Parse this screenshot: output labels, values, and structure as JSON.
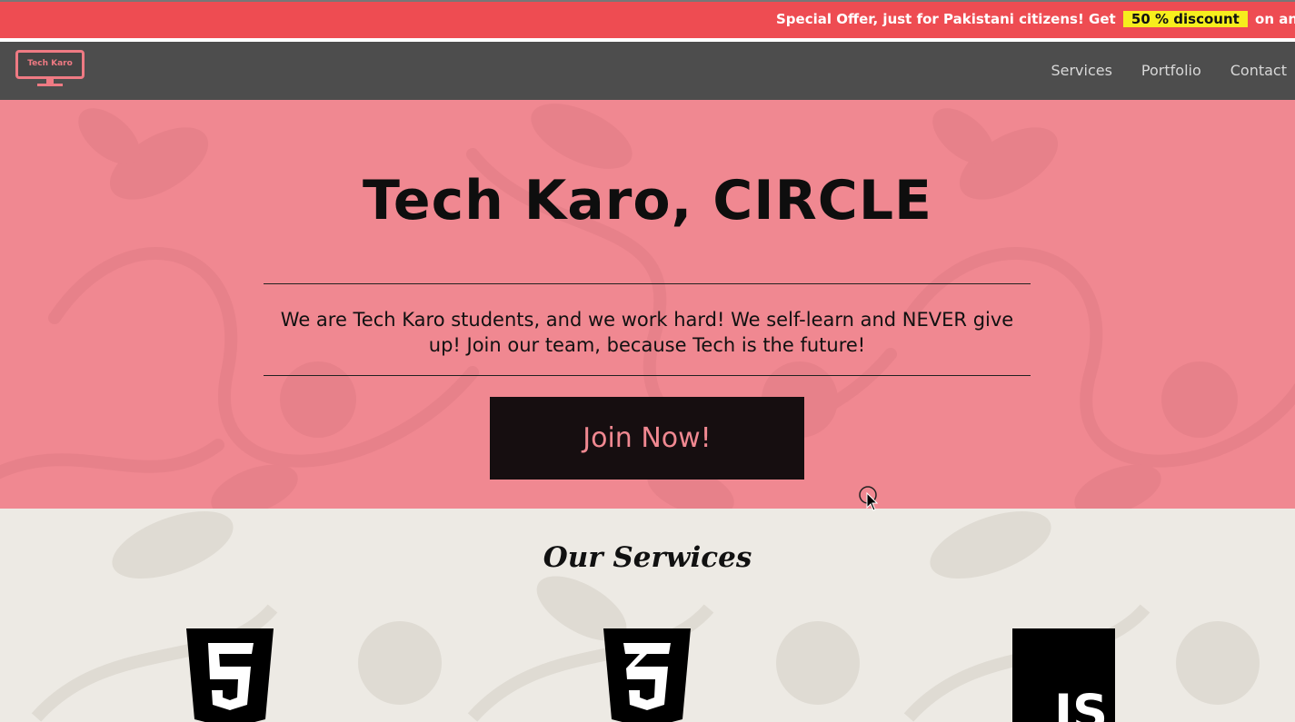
{
  "promo": {
    "text_before": "Special Offer, just for Pakistani citizens! Get",
    "highlight": "50 % discount",
    "text_after": "on any of t"
  },
  "nav": {
    "logo_text": "Tech Karo",
    "links": [
      "Services",
      "Portfolio",
      "Contact"
    ]
  },
  "hero": {
    "title": "Tech Karo, CIRCLE",
    "text": "We are Tech Karo students, and we work hard! We self-learn and NEVER give up! Join our team, because Tech is the future!",
    "button": "Join Now!"
  },
  "services": {
    "title": "Our Serwices",
    "icons": [
      "html5-icon",
      "css3-icon",
      "javascript-icon"
    ],
    "js_label": "JS"
  },
  "colors": {
    "promo_bg": "#ee4c52",
    "highlight_bg": "#f6ee1d",
    "nav_bg": "#4d4d4d",
    "hero_bg": "#f08891",
    "button_bg": "#160e10",
    "services_bg": "#edeae4"
  }
}
